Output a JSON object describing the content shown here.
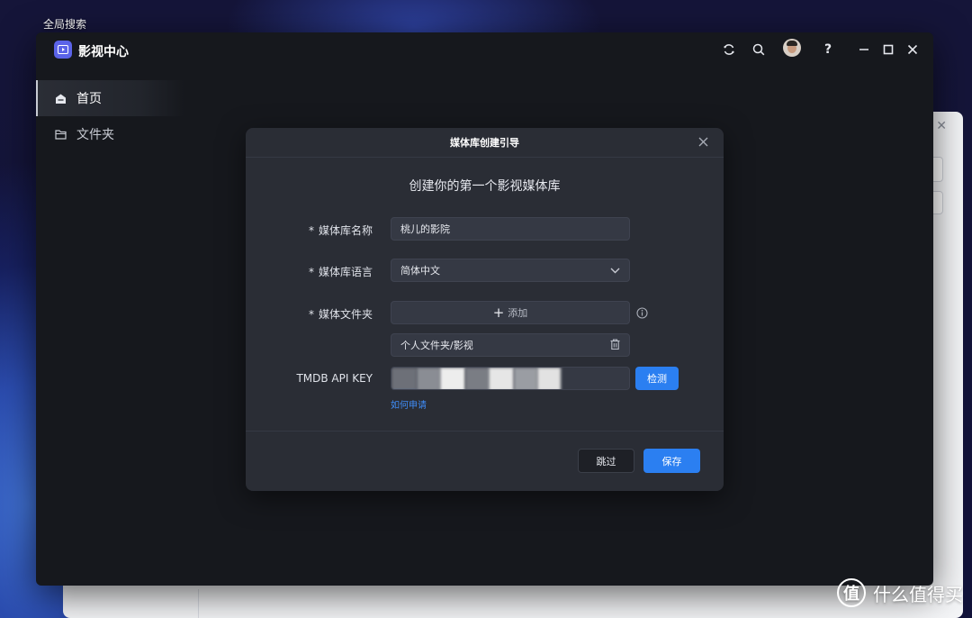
{
  "desktop": {
    "label": "全局搜索"
  },
  "app": {
    "title": "影视中心",
    "titlebar_icons": [
      "sync-icon",
      "search-icon",
      "avatar",
      "help-icon",
      "minimize-icon",
      "maximize-icon",
      "close-icon"
    ],
    "help_glyph": "?"
  },
  "sidebar": {
    "items": [
      {
        "label": "首页",
        "icon": "home-icon",
        "active": true
      },
      {
        "label": "文件夹",
        "icon": "folder-icon",
        "active": false
      }
    ]
  },
  "modal": {
    "title": "媒体库创建引导",
    "heading": "创建你的第一个影视媒体库",
    "required_mark": "*",
    "fields": {
      "name": {
        "label": "媒体库名称",
        "value": "桃儿的影院"
      },
      "language": {
        "label": "媒体库语言",
        "value": "简体中文"
      },
      "folder": {
        "label": "媒体文件夹",
        "add_label": "添加",
        "path": "个人文件夹/影视"
      },
      "apikey": {
        "label": "TMDB API KEY",
        "detect_label": "检测",
        "help_link": "如何申请"
      }
    },
    "buttons": {
      "skip": "跳过",
      "save": "保存"
    }
  },
  "watermark": {
    "text": "什么值得买",
    "logo_glyph": "值"
  },
  "colors": {
    "accent": "#2b7ff1",
    "app_bg": "#16181d",
    "modal_bg": "#2a2d35",
    "logo": "#5b63e8"
  }
}
